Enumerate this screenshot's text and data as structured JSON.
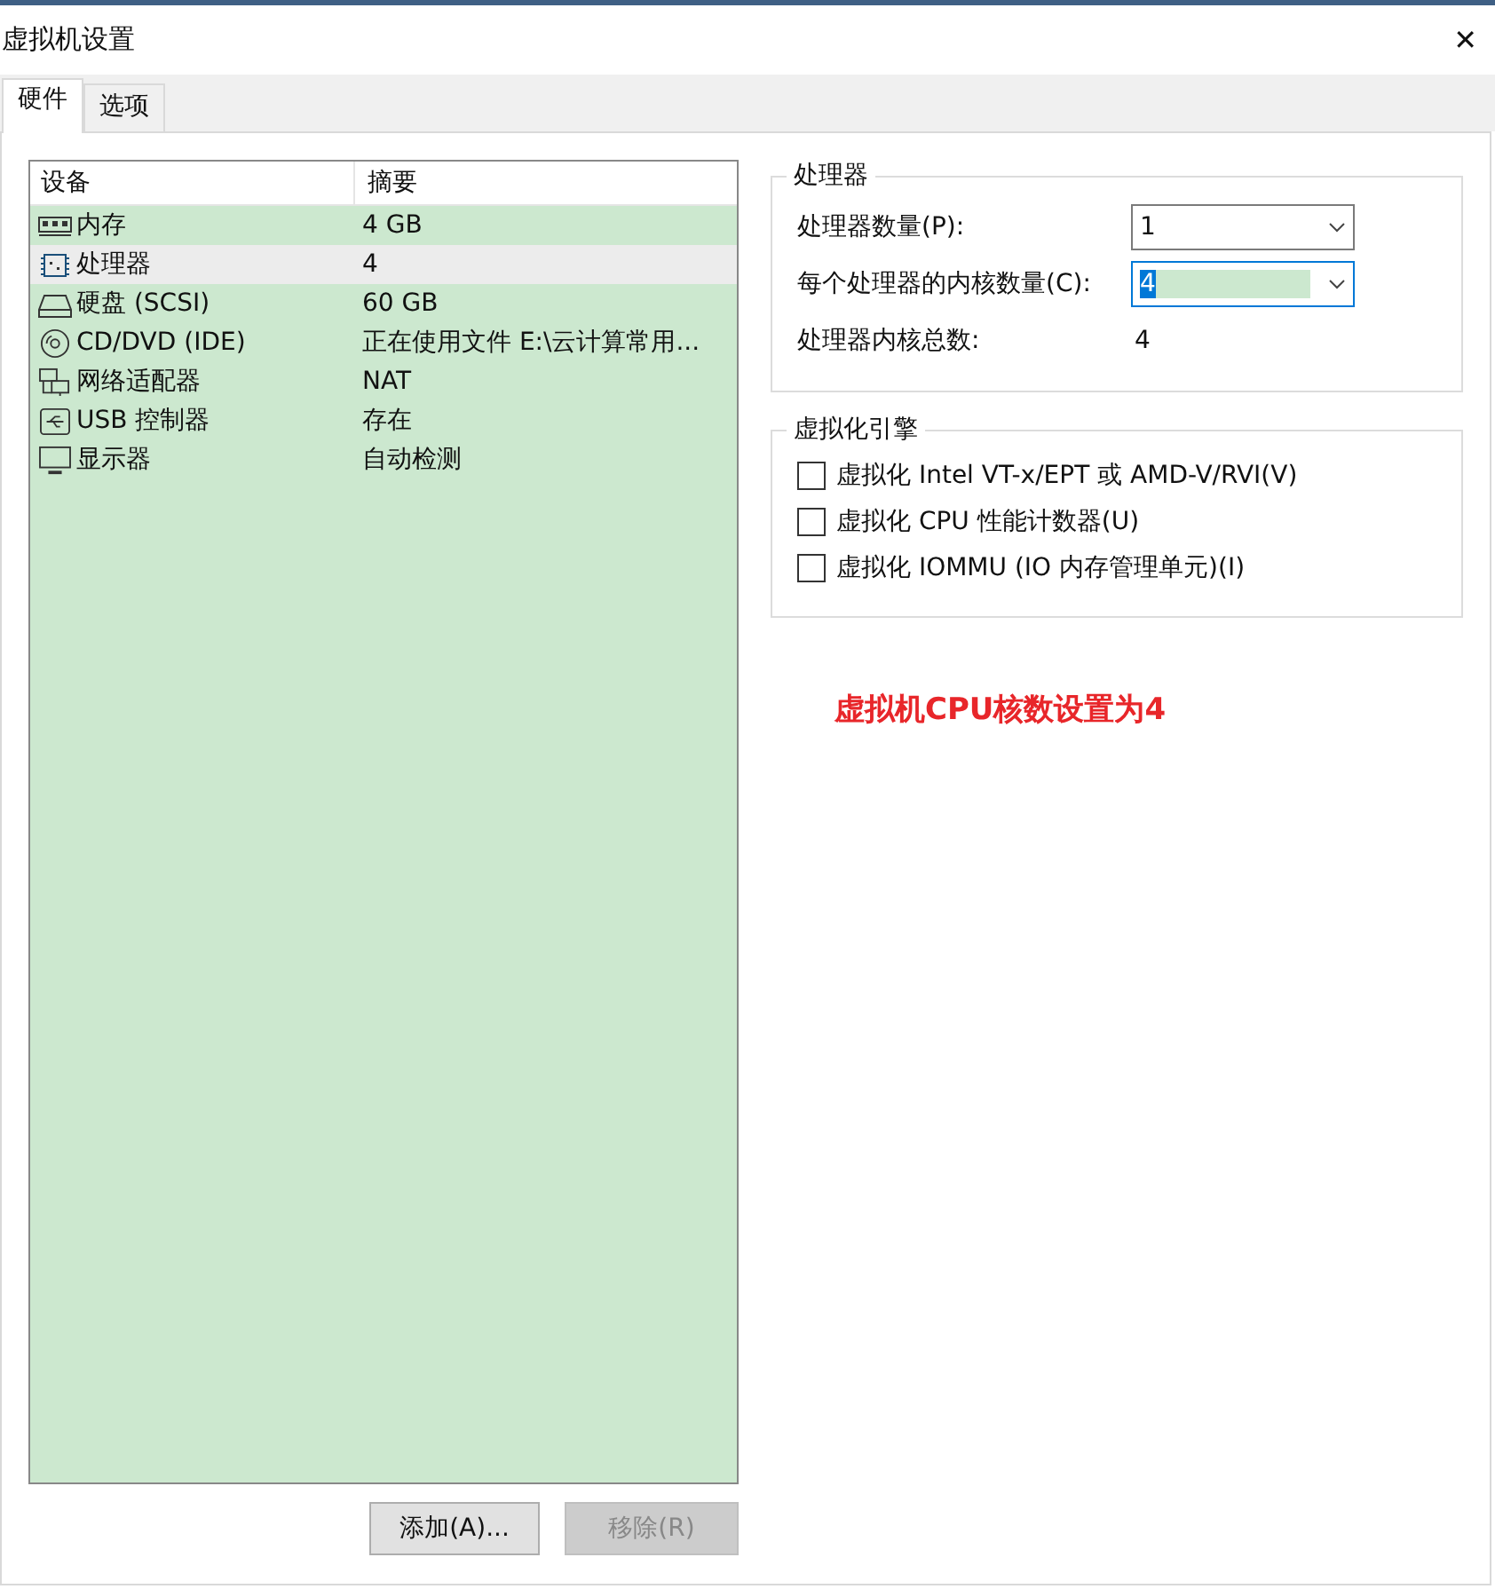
{
  "window": {
    "title": "虚拟机设置",
    "close": "✕"
  },
  "tabs": [
    {
      "label": "硬件",
      "selected": true
    },
    {
      "label": "选项",
      "selected": false
    }
  ],
  "devices": {
    "columns": [
      "设备",
      "摘要"
    ],
    "rows": [
      {
        "kind": "memory",
        "device": "内存",
        "summary": "4 GB",
        "selected": false
      },
      {
        "kind": "cpu",
        "device": "处理器",
        "summary": "4",
        "selected": true
      },
      {
        "kind": "disk",
        "device": "硬盘 (SCSI)",
        "summary": "60 GB",
        "selected": false
      },
      {
        "kind": "optical",
        "device": "CD/DVD (IDE)",
        "summary": "正在使用文件 E:\\云计算常用...",
        "selected": false
      },
      {
        "kind": "network",
        "device": "网络适配器",
        "summary": "NAT",
        "selected": false
      },
      {
        "kind": "usb",
        "device": "USB 控制器",
        "summary": "存在",
        "selected": false
      },
      {
        "kind": "display",
        "device": "显示器",
        "summary": "自动检测",
        "selected": false
      }
    ]
  },
  "buttons": [
    {
      "label": "添加(A)...",
      "disabled": false
    },
    {
      "label": "移除(R)",
      "disabled": true
    }
  ],
  "processors": {
    "title": "处理器",
    "fields": [
      {
        "label": "处理器数量(P):",
        "value": "1",
        "focused": false
      },
      {
        "label": "每个处理器的内核数量(C):",
        "value": "4",
        "focused": true
      }
    ],
    "total_label": "处理器内核总数:",
    "total_value": "4"
  },
  "virtualization": {
    "title": "虚拟化引擎",
    "options": [
      {
        "label": "虚拟化 Intel VT-x/EPT 或 AMD-V/RVI(V)",
        "checked": false
      },
      {
        "label": "虚拟化 CPU 性能计数器(U)",
        "checked": false
      },
      {
        "label": "虚拟化 IOMMU (IO 内存管理单元)(I)",
        "checked": false
      }
    ]
  },
  "annotation": "虚拟机CPU核数设置为4"
}
